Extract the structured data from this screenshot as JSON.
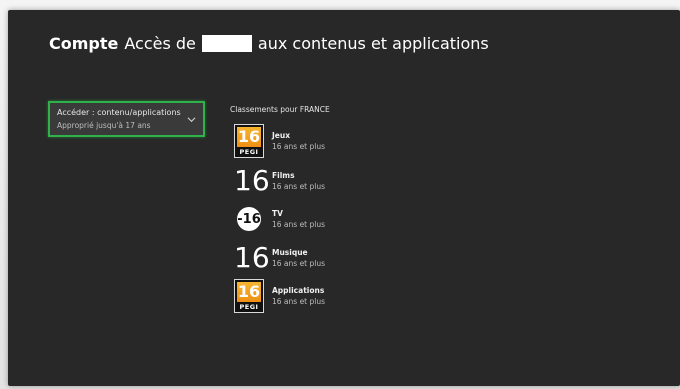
{
  "header": {
    "section": "Compte",
    "title_prefix": "Accès de",
    "title_suffix": "aux contenus et applications"
  },
  "access_card": {
    "line1": "Accéder : contenu/applications",
    "line2": "Approprié jusqu'à 17 ans"
  },
  "ratings": {
    "heading": "Classements pour FRANCE",
    "items": [
      {
        "badge_value": "16",
        "badge_label": "PEGI",
        "category": "Jeux",
        "age": "16 ans et plus"
      },
      {
        "badge_value": "16",
        "category": "Films",
        "age": "16 ans et plus"
      },
      {
        "badge_value": "-16",
        "category": "TV",
        "age": "16 ans et plus"
      },
      {
        "badge_value": "16",
        "category": "Musique",
        "age": "16 ans et plus"
      },
      {
        "badge_value": "16",
        "badge_label": "PEGI",
        "category": "Applications",
        "age": "16 ans et plus"
      }
    ]
  },
  "colors": {
    "background": "#282828",
    "focus_border": "#2fb24a",
    "pegi_orange": "#f4a020"
  }
}
